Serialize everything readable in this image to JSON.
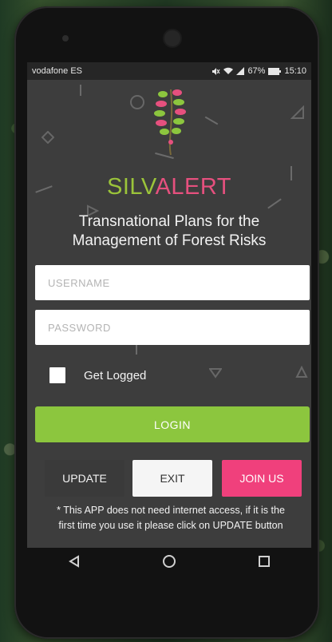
{
  "status_bar": {
    "carrier": "vodafone ES",
    "battery": "67%",
    "time": "15:10"
  },
  "brand": {
    "name_part1": "SILV",
    "name_part2": "ALERT",
    "color_silv": "#9bc43a",
    "color_alert": "#e6507e",
    "tagline_line1": "Transnational Plans for the",
    "tagline_line2": "Management of Forest Risks"
  },
  "form": {
    "username_placeholder": "USERNAME",
    "password_placeholder": "PASSWORD",
    "get_logged_label": "Get Logged",
    "get_logged_checked": false,
    "login_label": "LOGIN"
  },
  "actions": {
    "update_label": "UPDATE",
    "exit_label": "EXIT",
    "join_label": "JOIN US"
  },
  "note": {
    "line1": "* This APP does not need internet access, if it is the",
    "line2": "first time you use it please click on UPDATE button"
  },
  "nav": {
    "back_icon": "triangle-left",
    "home_icon": "circle",
    "recents_icon": "square"
  },
  "colors": {
    "login": "#8cc63e",
    "join": "#f0407c",
    "screen_bg": "#3d3d3d"
  }
}
